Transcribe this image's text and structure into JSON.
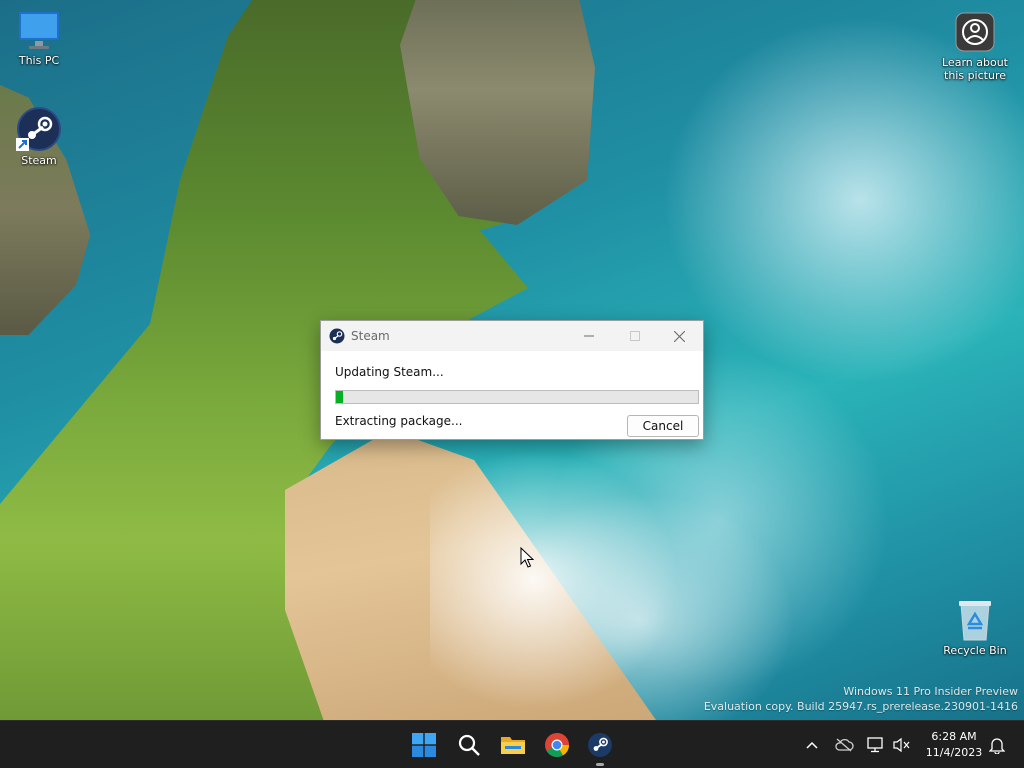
{
  "desktop": {
    "icons": [
      {
        "label": "This PC"
      },
      {
        "label": "Steam"
      },
      {
        "label": "Learn about this picture"
      },
      {
        "label": "Recycle Bin"
      }
    ]
  },
  "steam_window": {
    "title": "Steam",
    "status": "Updating Steam...",
    "progress_percent": 2,
    "detail": "Extracting package...",
    "cancel_label": "Cancel"
  },
  "watermark": {
    "line1": "Windows 11 Pro Insider Preview",
    "line2": "Evaluation copy. Build 25947.rs_prerelease.230901-1416"
  },
  "taskbar": {
    "apps": [
      "start-icon",
      "search-icon",
      "file-explorer-icon",
      "chrome-icon",
      "steam-icon"
    ],
    "clock": {
      "time": "6:28 AM",
      "date": "11/4/2023"
    }
  },
  "colors": {
    "progress_fill": "#06b025",
    "taskbar_bg": "#1f1f1f",
    "window_title_bg": "#f3f3f3"
  }
}
